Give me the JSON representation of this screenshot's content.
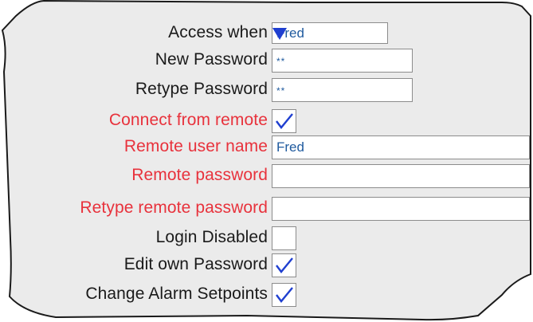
{
  "form": {
    "access_when": {
      "label": "Access when",
      "value": "Fred"
    },
    "new_password": {
      "label": "New Password",
      "value": "**"
    },
    "retype_password": {
      "label": "Retype Password",
      "value": "**"
    },
    "connect_remote": {
      "label": "Connect from remote",
      "checked": true
    },
    "remote_user": {
      "label": "Remote user name",
      "value": "Fred"
    },
    "remote_password": {
      "label": "Remote password",
      "value": ""
    },
    "retype_remote_password": {
      "label": "Retype remote password",
      "value": ""
    },
    "login_disabled": {
      "label": "Login Disabled",
      "checked": false
    },
    "edit_own_password": {
      "label": "Edit own Password",
      "checked": true
    },
    "change_alarm_setpoints": {
      "label": "Change Alarm Setpoints",
      "checked": true
    }
  },
  "colors": {
    "label_default": "#1a1a1a",
    "label_remote": "#e8323c",
    "panel_fill": "#ebebeb",
    "field_text": "#1f5a9e",
    "accent": "#1f3fd0"
  },
  "icons": {
    "dropdown": "triangle-down-icon",
    "check": "checkmark-icon"
  }
}
